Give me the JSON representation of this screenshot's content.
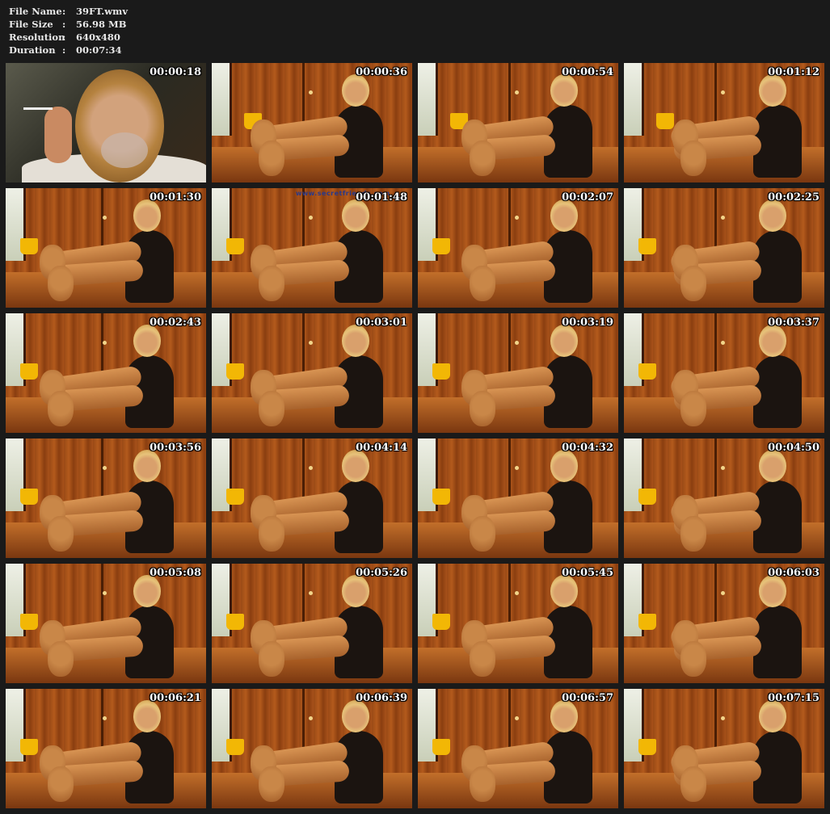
{
  "info": {
    "file_name": {
      "label": "File Name",
      "sep": ":",
      "value": "39FT.wmv"
    },
    "file_size": {
      "label": "File Size",
      "sep": ":",
      "value": "56.98 MB"
    },
    "resolution": {
      "label": "Resolution",
      "sep": ":",
      "value": "640x480"
    },
    "duration": {
      "label": "Duration",
      "sep": ":",
      "value": "00:07:34"
    }
  },
  "thumbnails": [
    {
      "time": "00:00:18"
    },
    {
      "time": "00:00:36"
    },
    {
      "time": "00:00:54"
    },
    {
      "time": "00:01:12"
    },
    {
      "time": "00:01:30"
    },
    {
      "time": "00:01:48"
    },
    {
      "time": "00:02:07"
    },
    {
      "time": "00:02:25"
    },
    {
      "time": "00:02:43"
    },
    {
      "time": "00:03:01"
    },
    {
      "time": "00:03:19"
    },
    {
      "time": "00:03:37"
    },
    {
      "time": "00:03:56"
    },
    {
      "time": "00:04:14"
    },
    {
      "time": "00:04:32"
    },
    {
      "time": "00:04:50"
    },
    {
      "time": "00:05:08"
    },
    {
      "time": "00:05:26"
    },
    {
      "time": "00:05:45"
    },
    {
      "time": "00:06:03"
    },
    {
      "time": "00:06:21"
    },
    {
      "time": "00:06:39"
    },
    {
      "time": "00:06:57"
    },
    {
      "time": "00:07:15"
    }
  ],
  "watermark": "www.secretfriends.com",
  "colors": {
    "background": "#1a1a1a",
    "text": "#e8e8e8",
    "timestamp": "#ffffff",
    "wood": "#a8521a",
    "cup": "#f2b705"
  }
}
